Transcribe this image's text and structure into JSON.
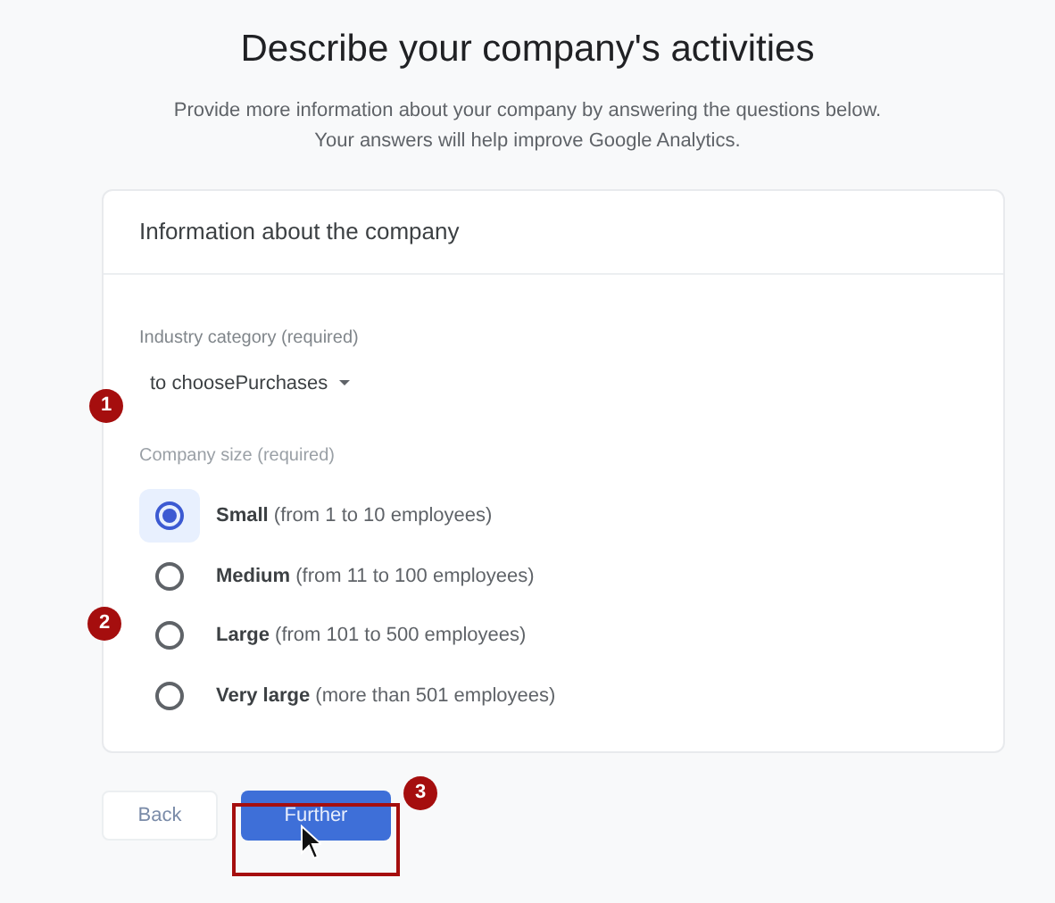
{
  "header": {
    "title": "Describe your company's activities",
    "subtitle_lines": [
      "Provide more information about your company by answering the questions below.",
      "Your answers will help improve Google Analytics."
    ]
  },
  "card": {
    "title": "Information about the company",
    "industry": {
      "label": "Industry category (required)",
      "value": "to choosePurchases"
    },
    "size": {
      "label": "Company size (required)",
      "options": [
        {
          "name": "Small",
          "detail": "(from 1 to 10 employees)",
          "selected": true
        },
        {
          "name": "Medium",
          "detail": "(from 11 to 100 employees)",
          "selected": false
        },
        {
          "name": "Large",
          "detail": "(from 101 to 500 employees)",
          "selected": false
        },
        {
          "name": "Very large",
          "detail": "(more than 501 employees)",
          "selected": false
        }
      ]
    }
  },
  "buttons": {
    "back": "Back",
    "next": "Further"
  },
  "markers": [
    "1",
    "2",
    "3"
  ]
}
